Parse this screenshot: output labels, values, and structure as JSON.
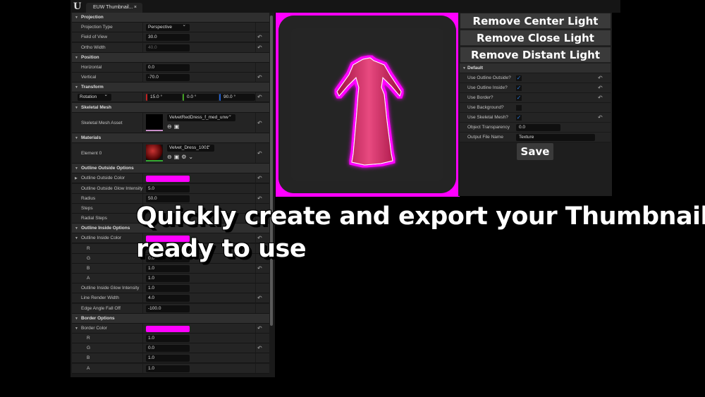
{
  "app": {
    "logo": "U",
    "tab_title": "EUW Thumbnail...",
    "tab_close": "×"
  },
  "details": [
    {
      "t": "hdr",
      "label": "Projection"
    },
    {
      "t": "prop",
      "label": "Projection Type",
      "kind": "dropdown",
      "value": "Perspective"
    },
    {
      "t": "prop",
      "label": "Field of View",
      "kind": "input",
      "value": "30.0",
      "reset": true
    },
    {
      "t": "prop",
      "label": "Ortho Width",
      "kind": "input",
      "value": "40.0",
      "disabled": true,
      "reset": true
    },
    {
      "t": "hdr",
      "label": "Position"
    },
    {
      "t": "prop",
      "label": "Horizontal",
      "kind": "input",
      "value": "0.0"
    },
    {
      "t": "prop",
      "label": "Vertical",
      "kind": "input",
      "value": "-70.0",
      "reset": true
    },
    {
      "t": "hdr",
      "label": "Transform"
    },
    {
      "t": "prop",
      "label": "Rotation",
      "kind": "rotation",
      "values": [
        "15.0 °",
        "0.0 °",
        "90.0 °"
      ],
      "reset": true
    },
    {
      "t": "hdr",
      "label": "Skeletal Mesh"
    },
    {
      "t": "tall",
      "label": "Skeletal Mesh Asset",
      "kind": "asset",
      "value": "VelvetRedDress_f_med_unw",
      "reset": true
    },
    {
      "t": "hdr",
      "label": "Materials"
    },
    {
      "t": "tall",
      "label": "Element 0",
      "kind": "material",
      "value": "Velvet_Dress_1001",
      "reset": true
    },
    {
      "t": "hdr",
      "label": "Outline Outside Options"
    },
    {
      "t": "prop",
      "label": "Outline Outside Color",
      "kind": "color",
      "arrow": "▶",
      "reset": true
    },
    {
      "t": "prop",
      "label": "Outline Outside Glow Intensity",
      "kind": "input",
      "value": "5.0"
    },
    {
      "t": "prop",
      "label": "Radius",
      "kind": "input",
      "value": "50.0",
      "reset": true
    },
    {
      "t": "prop",
      "label": "Steps"
    },
    {
      "t": "prop",
      "label": "Radial Steps"
    },
    {
      "t": "hdr",
      "label": "Outline Inside Options"
    },
    {
      "t": "prop",
      "label": "Outline Inside Color",
      "kind": "color",
      "arrow": "▼",
      "reset": true
    },
    {
      "t": "sub",
      "label": "R"
    },
    {
      "t": "sub",
      "label": "G",
      "kind": "input",
      "value": "0.0"
    },
    {
      "t": "sub",
      "label": "B",
      "kind": "input",
      "value": "1.0",
      "reset": true
    },
    {
      "t": "sub",
      "label": "A",
      "kind": "input",
      "value": "1.0"
    },
    {
      "t": "prop",
      "label": "Outline Inside Glow Intensity",
      "kind": "input",
      "value": "1.0"
    },
    {
      "t": "prop",
      "label": "Line Render Width",
      "kind": "input",
      "value": "4.0",
      "reset": true
    },
    {
      "t": "prop",
      "label": "Edge Angle Fall Off",
      "kind": "input",
      "value": "-100.0"
    },
    {
      "t": "hdr",
      "label": "Border Options"
    },
    {
      "t": "prop",
      "label": "Border Color",
      "kind": "color",
      "arrow": "▼",
      "reset": true
    },
    {
      "t": "sub",
      "label": "R",
      "kind": "input",
      "value": "1.0"
    },
    {
      "t": "sub",
      "label": "G",
      "kind": "input",
      "value": "0.0",
      "reset": true
    },
    {
      "t": "sub",
      "label": "B",
      "kind": "input",
      "value": "1.0"
    },
    {
      "t": "sub",
      "label": "A",
      "kind": "input",
      "value": "1.0"
    }
  ],
  "light_buttons": [
    "Remove Center Light",
    "Remove Close Light",
    "Remove Distant Light"
  ],
  "defaults": {
    "header": "Default",
    "rows": [
      {
        "label": "Use Outline Outside?",
        "kind": "check",
        "checked": true,
        "reset": true
      },
      {
        "label": "Use Outline Inside?",
        "kind": "check",
        "checked": true,
        "reset": true
      },
      {
        "label": "Use Border?",
        "kind": "check",
        "checked": true,
        "reset": true
      },
      {
        "label": "Use Background?",
        "kind": "check",
        "checked": false
      },
      {
        "label": "Use Skeletal Mesh?",
        "kind": "check",
        "checked": true,
        "reset": true
      },
      {
        "label": "Object Transparency",
        "kind": "input",
        "value": "0.0"
      },
      {
        "label": "Output File Name",
        "kind": "input",
        "value": "Texture",
        "wide": true
      }
    ],
    "save_label": "Save"
  },
  "headline": [
    "Quickly create and export your Thumbnails",
    "ready to use"
  ],
  "colors": {
    "outline": "#ff00ff",
    "dress": "#d8205a",
    "accent_check": "#2a7ad8"
  }
}
